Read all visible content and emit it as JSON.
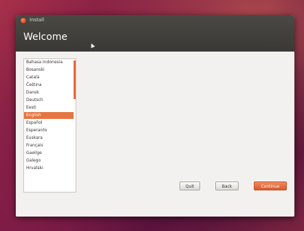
{
  "window": {
    "title": "Install",
    "page_title": "Welcome"
  },
  "languages": {
    "items": [
      "Bahasa Indonesia",
      "Bosanski",
      "Català",
      "Čeština",
      "Dansk",
      "Deutsch",
      "Eesti",
      "English",
      "Español",
      "Esperanto",
      "Euskara",
      "Français",
      "Gaeilge",
      "Galego",
      "Hrvatski"
    ],
    "selected": "English"
  },
  "buttons": {
    "quit": "Quit",
    "back": "Back",
    "continue": "Continue"
  },
  "colors": {
    "accent": "#e57642",
    "header": "#3c3b37",
    "window_bg": "#f2f1f0"
  }
}
